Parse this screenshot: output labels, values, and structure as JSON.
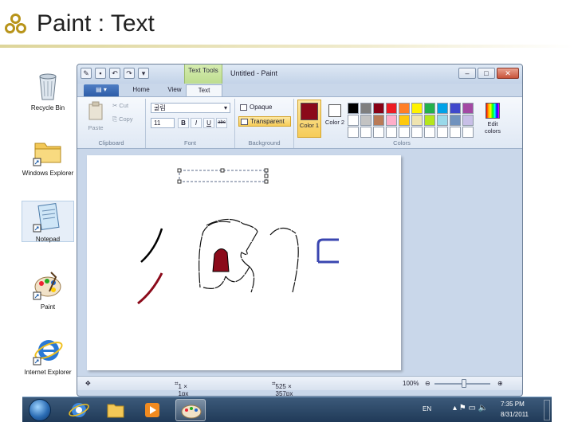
{
  "slide": {
    "title": "Paint : Text"
  },
  "desktop": {
    "icons": [
      {
        "label": "Recycle Bin"
      },
      {
        "label": "Windows Explorer"
      },
      {
        "label": "Notepad"
      },
      {
        "label": "Paint"
      },
      {
        "label": "Internet Explorer"
      }
    ]
  },
  "window": {
    "title": "Untitled - Paint",
    "context_tab": "Text Tools",
    "tabs": {
      "home": "Home",
      "view": "View",
      "text": "Text"
    },
    "clipboard": {
      "paste": "Paste",
      "cut": "Cut",
      "copy": "Copy",
      "label": "Clipboard"
    },
    "font": {
      "family": "굴림",
      "size": "11",
      "bold": "B",
      "italic": "I",
      "underline": "U",
      "strike": "abc",
      "label": "Font"
    },
    "background": {
      "opaque": "Opaque",
      "transparent": "Transparent",
      "label": "Background"
    },
    "colors": {
      "color1": "Color 1",
      "color2": "Color 2",
      "edit": "Edit colors",
      "label": "Colors",
      "color1_value": "#8b0a1a",
      "color2_value": "#ffffff",
      "palette": [
        "#000000",
        "#7f7f7f",
        "#880015",
        "#ed1c24",
        "#ff7f27",
        "#fff200",
        "#22b14c",
        "#00a2e8",
        "#3f48cc",
        "#a349a4",
        "#ffffff",
        "#c3c3c3",
        "#b97a57",
        "#ffaec9",
        "#ffc90e",
        "#efe4b0",
        "#b5e61d",
        "#99d9ea",
        "#7092be",
        "#c8bfe7",
        "#ffffff",
        "#ffffff",
        "#ffffff",
        "#ffffff",
        "#ffffff",
        "#ffffff",
        "#ffffff",
        "#ffffff",
        "#ffffff",
        "#ffffff"
      ]
    },
    "status": {
      "cursor": "1 × 1px",
      "size": "525 × 357px",
      "zoom": "100%"
    }
  },
  "taskbar": {
    "lang": "EN",
    "time": "7:35 PM",
    "date": "8/31/2011"
  }
}
